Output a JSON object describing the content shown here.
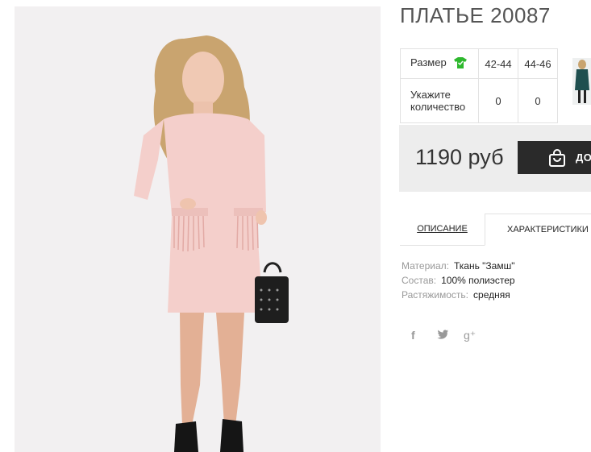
{
  "product": {
    "title": "ПЛАТЬЕ 20087",
    "image_alt": "Розовое платье с бахромой на карманах"
  },
  "sizes": {
    "size_label": "Размер",
    "qty_label": "Укажите количество",
    "size_icon": "tshirt-icon",
    "accent_color": "#2eb82e",
    "options": [
      {
        "size": "42-44",
        "qty": "0"
      },
      {
        "size": "44-46",
        "qty": "0"
      }
    ]
  },
  "price": {
    "amount": "1190 руб",
    "buy_label": "ДОБАВИТЬ"
  },
  "tabs": [
    {
      "label": "ОПИСАНИЕ",
      "active": false
    },
    {
      "label": "ХАРАКТЕРИСТИКИ",
      "active": true
    }
  ],
  "specs": [
    {
      "key": "Материал:",
      "value": "Ткань \"Замш\""
    },
    {
      "key": "Состав:",
      "value": "100% полиэстер"
    },
    {
      "key": "Растяжимость:",
      "value": "средняя"
    }
  ],
  "social": [
    {
      "icon": "facebook-icon",
      "glyph": "f"
    },
    {
      "icon": "twitter-icon",
      "glyph": "🐦"
    },
    {
      "icon": "google-plus-icon",
      "glyph": "g⁺"
    }
  ]
}
